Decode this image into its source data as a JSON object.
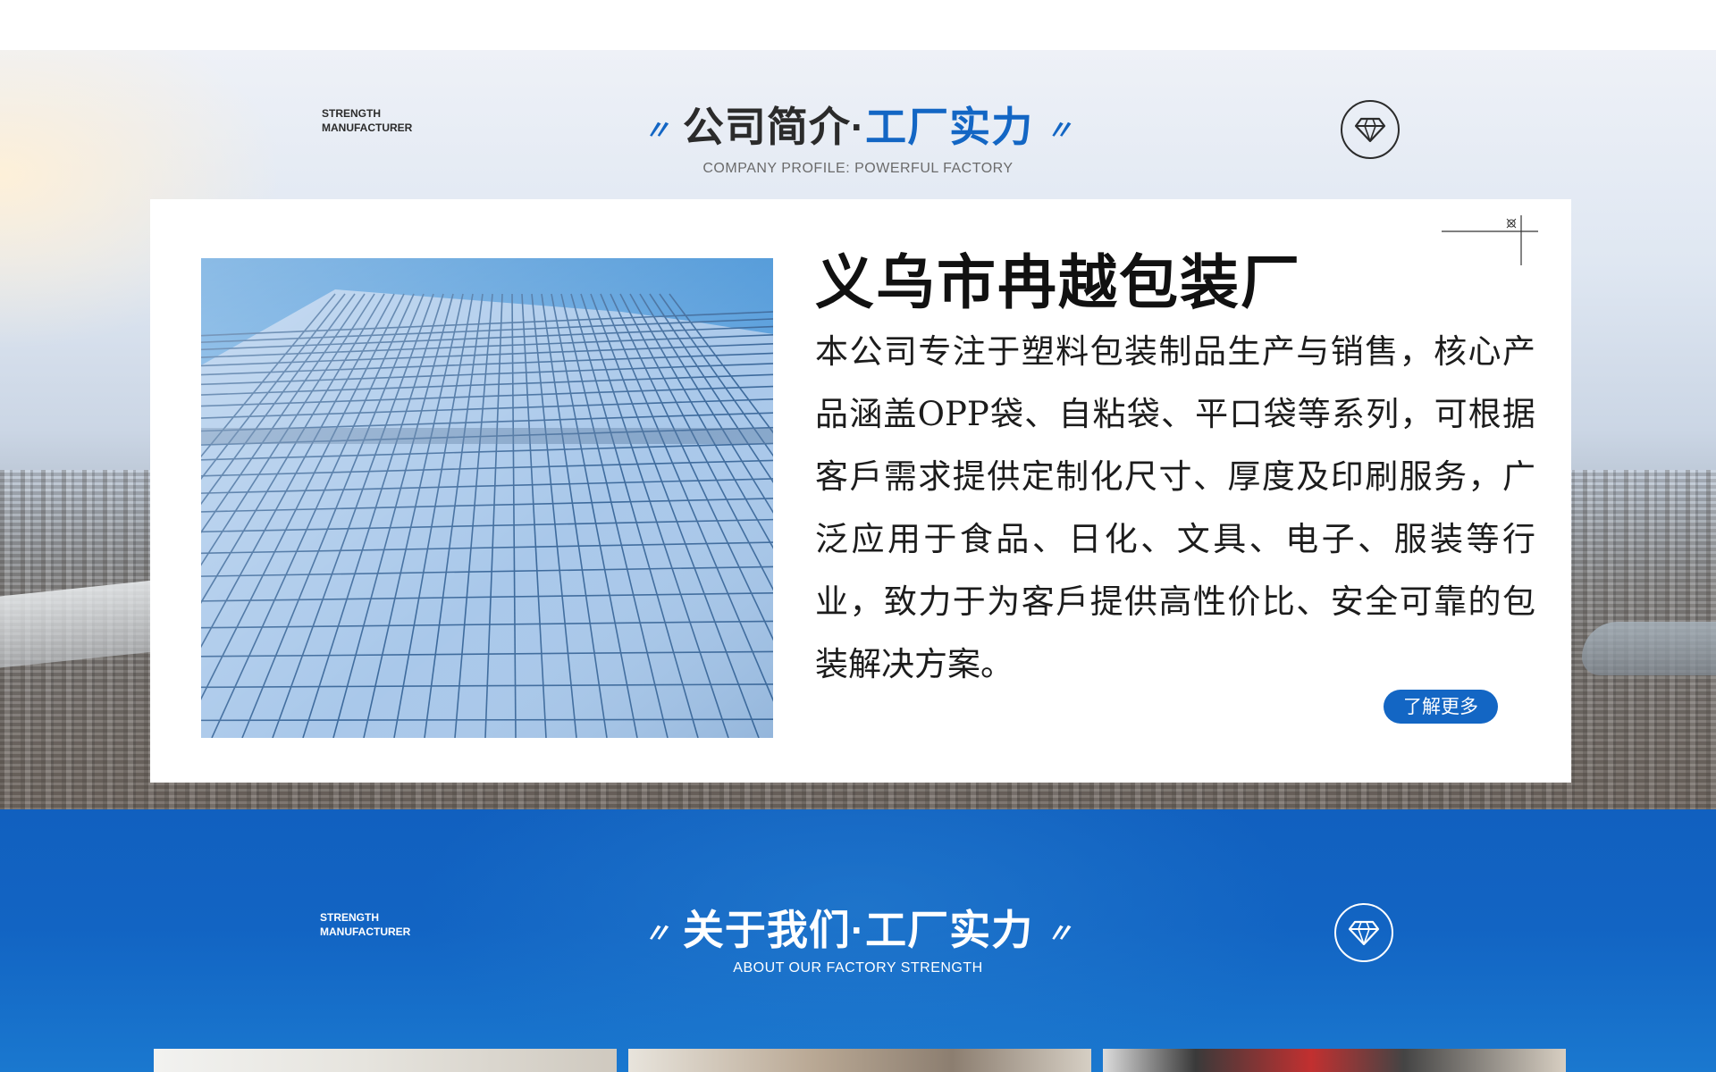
{
  "profile": {
    "tag_line1": "STRENGTH",
    "tag_line2": "MANUFACTURER",
    "title_part1": "公司简介·",
    "title_part2": "工厂实力",
    "subtitle": "COMPANY PROFILE: POWERFUL FACTORY",
    "icon": "diamond-icon",
    "company_name": "义乌市冉越包装厂",
    "description": "本公司专注于塑料包装制品生产与销售，核心产品涵盖OPP袋、自粘袋、平口袋等系列，可根据客戶需求提供定制化尺寸、厚度及印刷服务，广泛应用于食品、日化、文具、电子、服装等行业，致力于为客戶提供高性价比、安全可靠的包装解决方案。",
    "more_button": "了解更多"
  },
  "about": {
    "tag_line1": "STRENGTH",
    "tag_line2": "MANUFACTURER",
    "title": "关于我们·工厂实力",
    "subtitle": "ABOUT OUR FACTORY STRENGTH",
    "icon": "diamond-icon"
  },
  "colors": {
    "accent_blue": "#1366c4",
    "dark_text": "#2b2b2b",
    "section_blue": "#1264c3"
  }
}
